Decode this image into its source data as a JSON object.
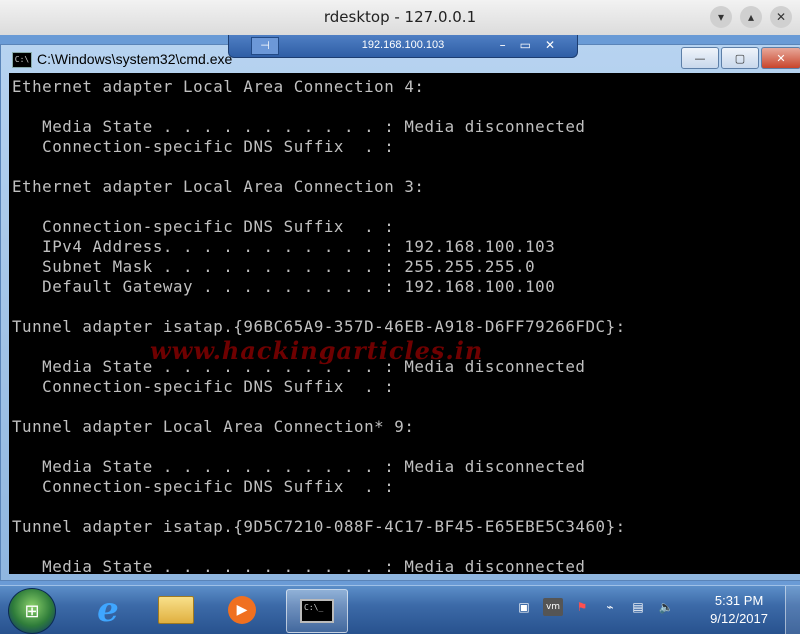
{
  "outer_window": {
    "title": "rdesktop - 127.0.0.1",
    "buttons": {
      "minimize": "▾",
      "restore": "▴",
      "close": "✕"
    }
  },
  "rdp_bar": {
    "ip": "192.168.100.103",
    "pin_icon": "pin-icon",
    "controls": {
      "minimize": "–",
      "restore": "▭",
      "close": "✕"
    }
  },
  "cmd_window": {
    "title": "C:\\Windows\\system32\\cmd.exe",
    "icon_text": "C:\\",
    "buttons": {
      "minimize": "—",
      "maximize": "▢",
      "close": "✕"
    }
  },
  "console_lines": [
    "Ethernet adapter Local Area Connection 4:",
    "",
    "   Media State . . . . . . . . . . . : Media disconnected",
    "   Connection-specific DNS Suffix  . :",
    "",
    "Ethernet adapter Local Area Connection 3:",
    "",
    "   Connection-specific DNS Suffix  . :",
    "   IPv4 Address. . . . . . . . . . . : 192.168.100.103",
    "   Subnet Mask . . . . . . . . . . . : 255.255.255.0",
    "   Default Gateway . . . . . . . . . : 192.168.100.100",
    "",
    "Tunnel adapter isatap.{96BC65A9-357D-46EB-A918-D6FF79266FDC}:",
    "",
    "   Media State . . . . . . . . . . . : Media disconnected",
    "   Connection-specific DNS Suffix  . :",
    "",
    "Tunnel adapter Local Area Connection* 9:",
    "",
    "   Media State . . . . . . . . . . . : Media disconnected",
    "   Connection-specific DNS Suffix  . :",
    "",
    "Tunnel adapter isatap.{9D5C7210-088F-4C17-BF45-E65EBE5C3460}:",
    "",
    "   Media State . . . . . . . . . . . : Media disconnected"
  ],
  "watermark": "www.hackingarticles.in",
  "taskbar": {
    "start_icon": "windows-logo-icon",
    "items": [
      {
        "name": "internet-explorer",
        "glyph": "e"
      },
      {
        "name": "file-explorer",
        "glyph": "📁"
      },
      {
        "name": "media-player",
        "glyph": "▶"
      }
    ],
    "tray": [
      "network-icon",
      "vm-icon",
      "action-center-icon",
      "usb-icon",
      "power-icon",
      "volume-icon"
    ],
    "time": "5:31 PM",
    "date": "9/12/2017"
  }
}
